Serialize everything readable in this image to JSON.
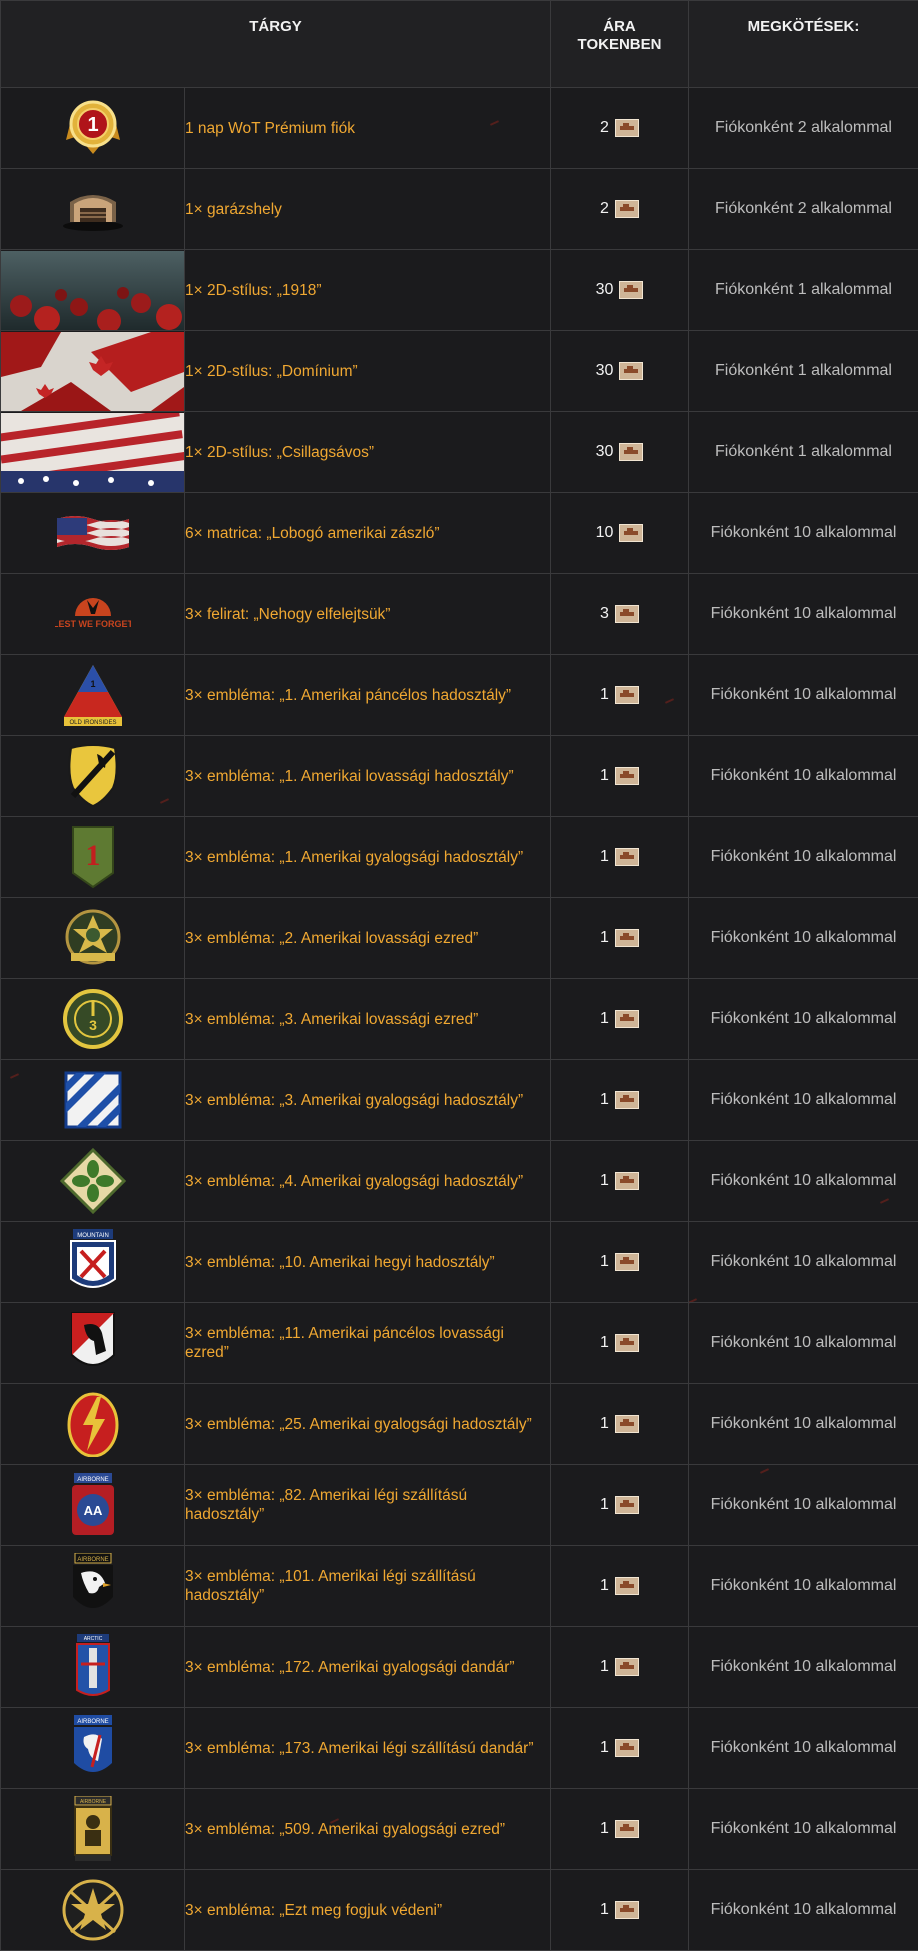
{
  "header": {
    "item": "TÁRGY",
    "price_line1": "ÁRA",
    "price_line2": "TOKENBEN",
    "limits": "MEGKÖTÉSEK:"
  },
  "rows": [
    {
      "icon": "premium-account-medal-icon",
      "name": "1 nap WoT Prémium fiók",
      "price": "2",
      "limit": "Fiókonként 2 alkalommal"
    },
    {
      "icon": "garage-slot-icon",
      "name": "1× garázshely",
      "price": "2",
      "limit": "Fiókonként 2 alkalommal"
    },
    {
      "icon": "style-1918-poppies-banner",
      "name": "1× 2D-stílus: „1918”",
      "price": "30",
      "limit": "Fiókonként 1 alkalommal"
    },
    {
      "icon": "style-dominion-maple-banner",
      "name": "1× 2D-stílus: „Domínium”",
      "price": "30",
      "limit": "Fiókonként 1 alkalommal"
    },
    {
      "icon": "style-stars-and-stripes-banner",
      "name": "1× 2D-stílus: „Csillagsávos”",
      "price": "30",
      "limit": "Fiókonként 1 alkalommal"
    },
    {
      "icon": "us-flag-decal-icon",
      "name": "6× matrica: „Lobogó amerikai zászló”",
      "price": "10",
      "limit": "Fiókonként 10 alkalommal"
    },
    {
      "icon": "lest-we-forget-inscription-icon",
      "name": "3× felirat: „Nehogy elfelejtsük”",
      "price": "3",
      "limit": "Fiókonként 10 alkalommal",
      "icon_text": "LEST WE FORGET"
    },
    {
      "icon": "armored-division-emblem-icon",
      "name": "3× embléma: „1. Amerikai páncélos hadosztály”",
      "price": "1",
      "limit": "Fiókonként 10 alkalommal"
    },
    {
      "icon": "cavalry-division-emblem-icon",
      "name": "3× embléma: „1. Amerikai lovassági hadosztály”",
      "price": "1",
      "limit": "Fiókonként 10 alkalommal"
    },
    {
      "icon": "infantry-division-1-emblem-icon",
      "name": "3× embléma: „1. Amerikai gyalogsági hadosztály”",
      "price": "1",
      "limit": "Fiókonként 10 alkalommal"
    },
    {
      "icon": "cavalry-regiment-2-emblem-icon",
      "name": "3× embléma: „2. Amerikai lovassági ezred”",
      "price": "1",
      "limit": "Fiókonként 10 alkalommal"
    },
    {
      "icon": "cavalry-regiment-3-emblem-icon",
      "name": "3× embléma: „3. Amerikai lovassági ezred”",
      "price": "1",
      "limit": "Fiókonként 10 alkalommal"
    },
    {
      "icon": "infantry-division-3-emblem-icon",
      "name": "3× embléma: „3. Amerikai gyalogsági hadosztály”",
      "price": "1",
      "limit": "Fiókonként 10 alkalommal"
    },
    {
      "icon": "infantry-division-4-emblem-icon",
      "name": "3× embléma: „4. Amerikai gyalogsági hadosztály”",
      "price": "1",
      "limit": "Fiókonként 10 alkalommal"
    },
    {
      "icon": "mountain-division-10-emblem-icon",
      "name": "3× embléma: „10. Amerikai hegyi hadosztály”",
      "price": "1",
      "limit": "Fiókonként 10 alkalommal"
    },
    {
      "icon": "armored-cavalry-11-emblem-icon",
      "name": "3× embléma: „11. Amerikai páncélos lovassági ezred”",
      "price": "1",
      "limit": "Fiókonként 10 alkalommal"
    },
    {
      "icon": "infantry-division-25-emblem-icon",
      "name": "3× embléma: „25. Amerikai gyalogsági hadosztály”",
      "price": "1",
      "limit": "Fiókonként 10 alkalommal"
    },
    {
      "icon": "airborne-82-emblem-icon",
      "name": "3× embléma: „82. Amerikai légi szállítású hadosztály”",
      "price": "1",
      "limit": "Fiókonként 10 alkalommal"
    },
    {
      "icon": "airborne-101-eagle-emblem-icon",
      "name": "3× embléma: „101. Amerikai légi szállítású hadosztály”",
      "price": "1",
      "limit": "Fiókonként 10 alkalommal"
    },
    {
      "icon": "infantry-brigade-172-emblem-icon",
      "name": "3× embléma: „172. Amerikai gyalogsági dandár”",
      "price": "1",
      "limit": "Fiókonként 10 alkalommal"
    },
    {
      "icon": "airborne-173-emblem-icon",
      "name": "3× embléma: „173. Amerikai légi szállítású dandár”",
      "price": "1",
      "limit": "Fiókonként 10 alkalommal"
    },
    {
      "icon": "infantry-regiment-509-emblem-icon",
      "name": "3× embléma: „509. Amerikai gyalogsági ezred”",
      "price": "1",
      "limit": "Fiókonként 10 alkalommal"
    },
    {
      "icon": "star-rifles-emblem-icon",
      "name": "3× embléma: „Ezt meg fogjuk védeni”",
      "price": "1",
      "limit": "Fiókonként 10 alkalommal"
    }
  ],
  "token_icon": "tank-token-icon",
  "colors": {
    "item_text": "#f0a832",
    "limit_text": "#bdbdbd",
    "background": "#1b1b1d",
    "grid": "#3a3a3c"
  }
}
